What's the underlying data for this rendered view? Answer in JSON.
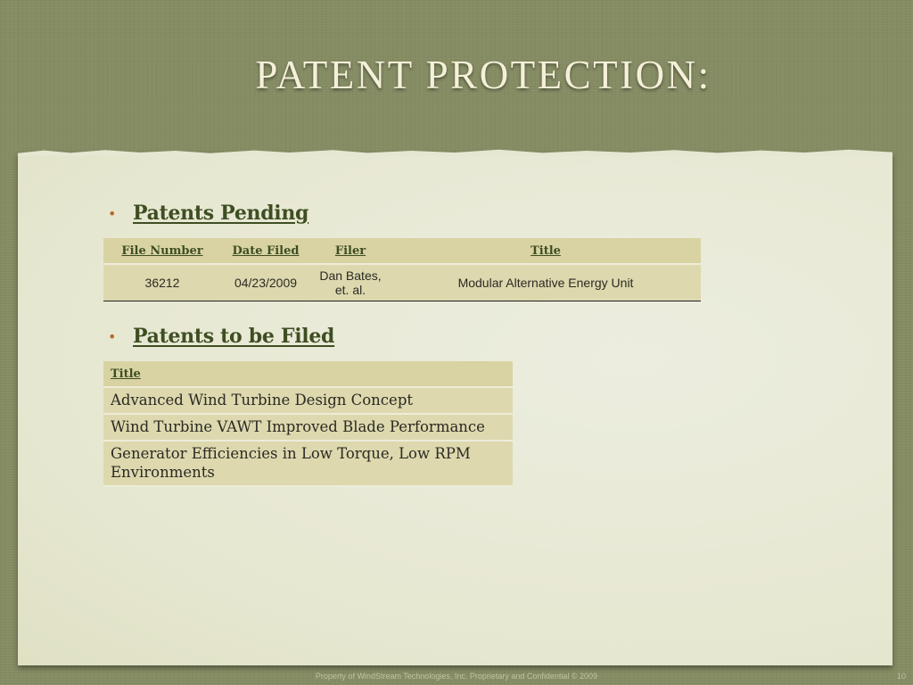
{
  "slide": {
    "title": "Patent Protection:"
  },
  "sections": {
    "pending": {
      "heading": "Patents Pending",
      "columns": [
        "File Number",
        "Date Filed",
        "Filer",
        "Title"
      ],
      "rows": [
        {
          "file_number": "36212",
          "date_filed": "04/23/2009",
          "filer_line1": "Dan Bates,",
          "filer_line2": "et. al.",
          "title": "Modular Alternative Energy Unit"
        }
      ]
    },
    "to_be_filed": {
      "heading": "Patents to be Filed",
      "column": "Title",
      "rows": [
        "Advanced Wind Turbine Design Concept",
        "Wind Turbine VAWT Improved Blade Performance",
        "Generator Efficiencies in Low Torque, Low RPM Environments"
      ]
    }
  },
  "bullet": "•",
  "footer": {
    "text": "Property of WindStream Technologies, Inc.  Proprietary and Confidential  © 2009",
    "page_number": "10"
  },
  "colors": {
    "background": "#858c63",
    "paper": "#e9ead6",
    "table_header": "#d9d3a3",
    "table_cell": "#ddd8ae",
    "heading_text": "#3e4e22",
    "bullet": "#b86a2b"
  }
}
